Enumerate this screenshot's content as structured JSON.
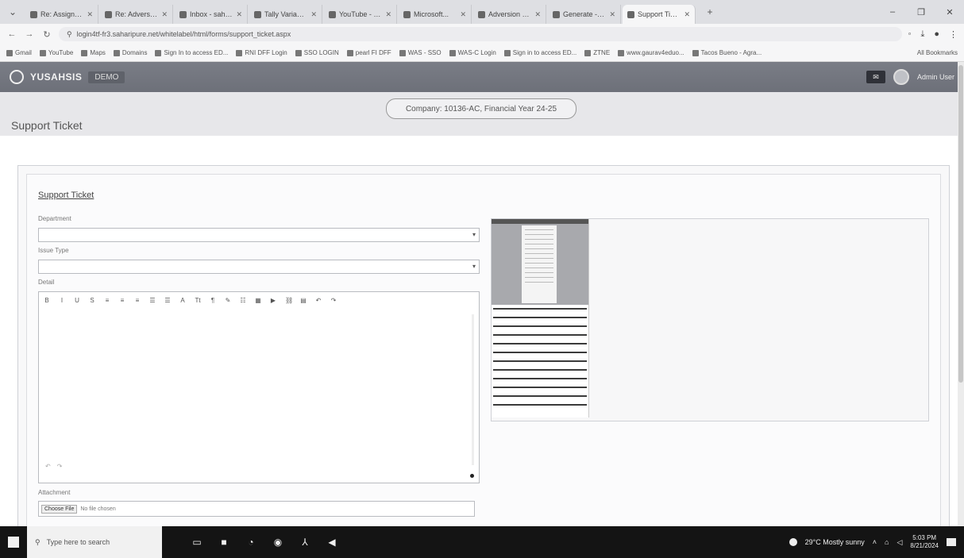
{
  "browser": {
    "tabs": [
      {
        "label": "Re: Assigned a..."
      },
      {
        "label": "Re: Adversion Curre..."
      },
      {
        "label": "Inbox - saharipure..."
      },
      {
        "label": "Tally Variable - Mix..."
      },
      {
        "label": "YouTube - Recept..."
      },
      {
        "label": "Microsoft..."
      },
      {
        "label": "Adversion Develop..."
      },
      {
        "label": "Generate - Mu..."
      },
      {
        "label": "Support Ticket - Y..."
      }
    ],
    "url": "login4tf-fr3.saharipure.net/whitelabel/html/forms/support_ticket.aspx",
    "bookmarks": [
      "Gmail",
      "YouTube",
      "Maps",
      "Domains",
      "Sign In to access ED...",
      "RNI DFF Login",
      "SSO LOGIN",
      "pearl FI DFF",
      "WAS - SSO",
      "WAS-C Login",
      "Sign in to access ED...",
      "ZTNE",
      "www.gaurav4eduo...",
      "Tacos Bueno - Agra..."
    ],
    "all_bookmarks": "All Bookmarks",
    "window_controls": [
      "–",
      "❐",
      "✕"
    ]
  },
  "app": {
    "brand": "YUSAHSIS",
    "brand_tag": "DEMO",
    "user_name": "Admin User",
    "company_info": "Company: 10136-AC, Financial Year 24-25",
    "page_title": "Support Ticket"
  },
  "form": {
    "card_title": "Support Ticket",
    "department_label": "Department",
    "department_value": "",
    "issue_type_label": "Issue Type",
    "issue_type_value": "",
    "detail_label": "Detail",
    "toolbar": [
      "B",
      "I",
      "U",
      "S",
      "≡",
      "≡",
      "≡",
      "☰",
      "☰",
      "A",
      "Tt",
      "¶",
      "✎",
      "☷",
      "▦",
      "▶",
      "⛓",
      "▤",
      "↶",
      "↷"
    ],
    "attachment_label": "Attachment",
    "choose_file": "Choose File",
    "file_status": "No file chosen"
  },
  "taskbar": {
    "search_placeholder": "Type here to search",
    "weather": "29°C  Mostly sunny",
    "time": "5:03 PM",
    "date": "8/21/2024"
  }
}
